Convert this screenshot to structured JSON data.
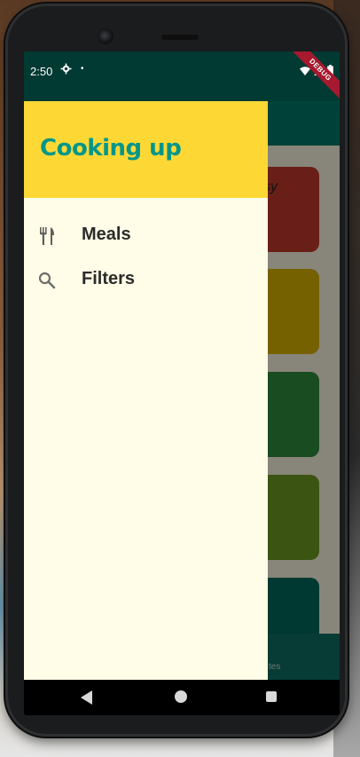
{
  "status_bar": {
    "time": "2:50",
    "gear_icon": "gear-icon",
    "dot": "•",
    "wifi_icon": "wifi-icon",
    "signal_icon": "signal-icon",
    "battery_icon": "battery-icon",
    "debug_badge": "DEBUG"
  },
  "background_app": {
    "visible_text": "sy",
    "bottom_nav_text": "tes",
    "tile_colors": [
      "#c0392b",
      "#d8b100",
      "#2f8a3c",
      "#6d9a22",
      "#00695c"
    ]
  },
  "drawer": {
    "title": "Cooking up",
    "items": [
      {
        "label": "Meals",
        "icon": "restaurant-icon"
      },
      {
        "label": "Filters",
        "icon": "search-icon"
      }
    ]
  },
  "colors": {
    "drawer_header": "#fdd835",
    "drawer_title": "#009688",
    "drawer_bg": "#fffde7",
    "status_bar": "#013a33"
  },
  "system_nav": {
    "back_icon": "back-triangle-icon",
    "home_icon": "home-circle-icon",
    "recents_icon": "recents-square-icon"
  }
}
